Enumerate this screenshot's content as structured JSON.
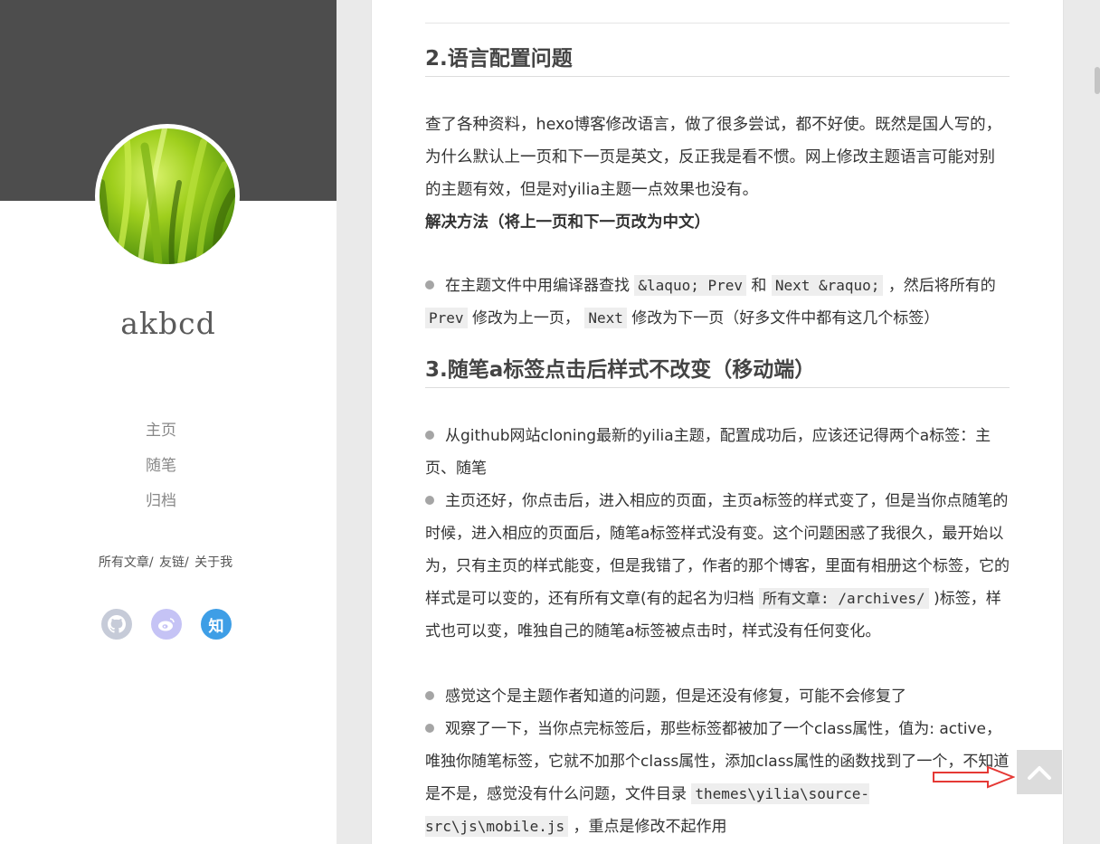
{
  "sidebar": {
    "site_name": "akbcd",
    "nav": [
      "主页",
      "随笔",
      "归档"
    ],
    "sublinks": [
      "所有文章/",
      "友链/",
      "关于我"
    ],
    "social": [
      {
        "icon": "github-icon",
        "color": "#c6cbd8"
      },
      {
        "icon": "weibo-icon",
        "color": "#c5c3f5"
      },
      {
        "icon": "zhihu-icon",
        "label": "知",
        "color": "#3e9ee6"
      }
    ]
  },
  "article": {
    "section2": {
      "title": "2.语言配置问题",
      "para": "查了各种资料，hexo博客修改语言，做了很多尝试，都不好使。既然是国人写的，为什么默认上一页和下一页是英文，反正我是看不惯。网上修改主题语言可能对别的主题有效，但是对yilia主题一点效果也没有。",
      "solution": "解决方法（将上一页和下一页改为中文）",
      "item1": {
        "t1": "在主题文件中用编译器查找",
        "c1": "&laquo; Prev",
        "t2": "和",
        "c2": "Next &raquo;",
        "t3": "，然后将所有的",
        "c3": "Prev",
        "t4": "修改为上一页，",
        "c4": "Next",
        "t5": "修改为下一页（好多文件中都有这几个标签）"
      }
    },
    "section3": {
      "title": "3.随笔a标签点击后样式不改变（移动端）",
      "item1": "从github网站cloning最新的yilia主题，配置成功后，应该还记得两个a标签：主页、随笔",
      "item2": {
        "t1": "主页还好，你点击后，进入相应的页面，主页a标签的样式变了，但是当你点随笔的时候，进入相应的页面后，随笔a标签样式没有变。这个问题困惑了我很久，最开始以为，只有主页的样式能变，但是我错了，作者的那个博客，里面有相册这个标签，它的样式是可以变的，还有所有文章(有的起名为归档",
        "c1": "所有文章: /archives/",
        "t2": ")标签，样式也可以变，唯独自己的随笔a标签被点击时，样式没有任何变化。"
      },
      "item3": "感觉这个是主题作者知道的问题，但是还没有修复，可能不会修复了",
      "item4": {
        "t1": "观察了一下，当你点完标签后，那些标签都被加了一个class属性，值为:",
        "t2": "active，唯独你随笔标签，它就不加那个class属性，添加class属性的函数找到了一个，不知道是不是，感觉没有什么问题，文件目录",
        "c1": "themes\\yilia\\source-src\\js\\mobile.js",
        "t3": "，重点是修改不起作用"
      }
    }
  },
  "colors": {
    "banner": "#4d4d4d",
    "annotation_arrow": "#e53935",
    "back_top_bg": "#dcdcdc"
  }
}
